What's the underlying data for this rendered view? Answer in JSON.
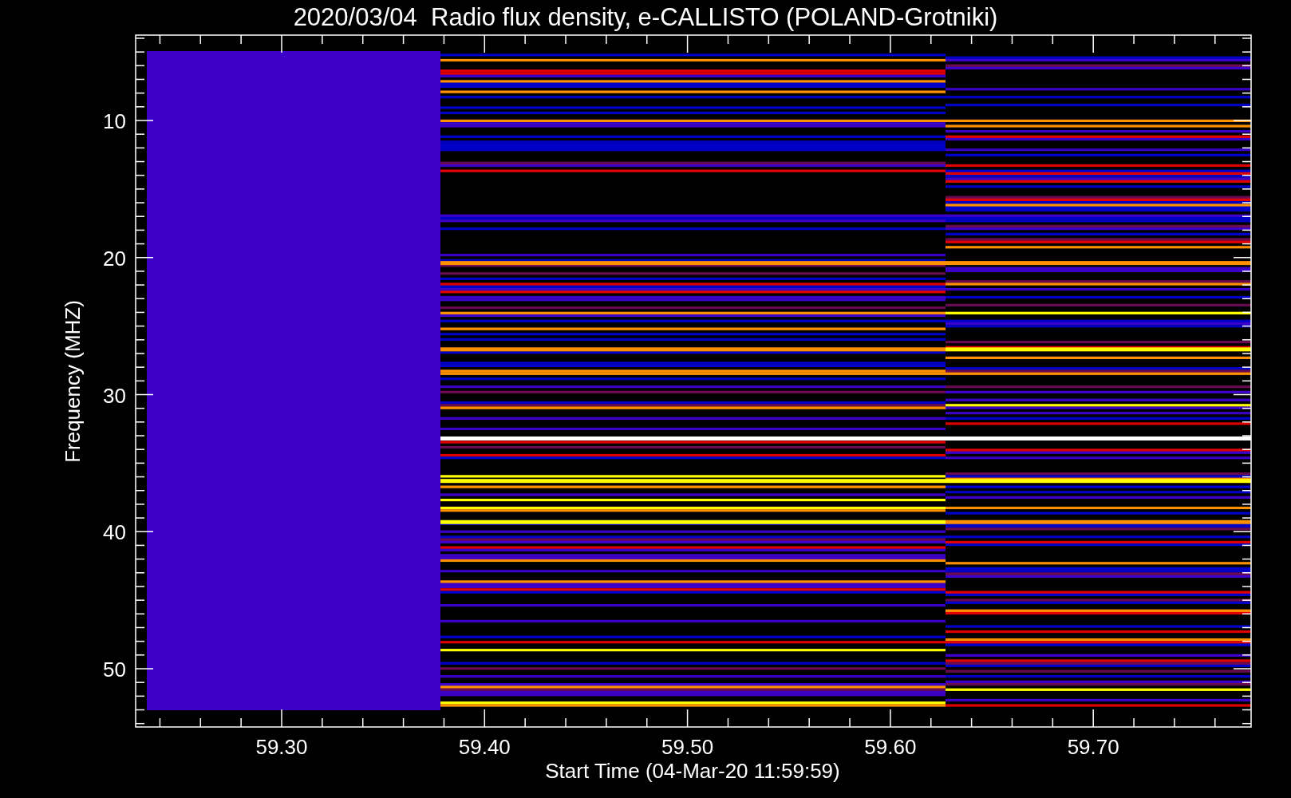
{
  "title": "2020/03/04  Radio flux density, e-CALLISTO (POLAND-Grotniki)",
  "y_axis": {
    "label": "Frequency (MHZ)",
    "ticks": [
      "10",
      "20",
      "30",
      "40",
      "50"
    ]
  },
  "x_axis": {
    "label": "Start Time (04-Mar-20 11:59:59)",
    "ticks": [
      "59.30",
      "59.40",
      "59.50",
      "59.60",
      "59.70"
    ]
  }
}
